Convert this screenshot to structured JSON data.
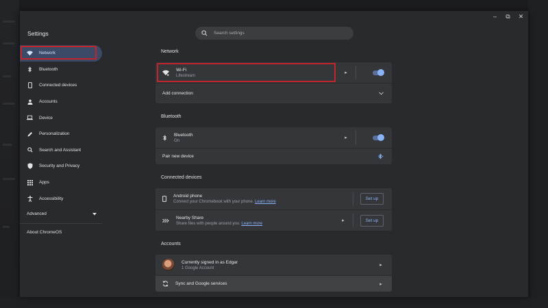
{
  "window": {
    "title": "Settings",
    "controls": [
      "–",
      "⧉",
      "✕"
    ]
  },
  "search": {
    "placeholder": "Search settings"
  },
  "sidebar": {
    "items": [
      {
        "label": "Network",
        "icon": "wifi-icon",
        "active": true
      },
      {
        "label": "Bluetooth",
        "icon": "bluetooth-icon"
      },
      {
        "label": "Connected devices",
        "icon": "phone-icon"
      },
      {
        "label": "Accounts",
        "icon": "person-icon"
      },
      {
        "label": "Device",
        "icon": "laptop-icon"
      },
      {
        "label": "Personalization",
        "icon": "pen-icon"
      },
      {
        "label": "Search and Assistant",
        "icon": "search-icon"
      },
      {
        "label": "Security and Privacy",
        "icon": "shield-icon"
      },
      {
        "label": "Apps",
        "icon": "apps-grid-icon"
      },
      {
        "label": "Accessibility",
        "icon": "accessibility-icon"
      }
    ],
    "advanced": "Advanced",
    "about": "About ChromeOS"
  },
  "network": {
    "title": "Network",
    "wifi": {
      "label": "Wi-Fi",
      "network": "Lifestream",
      "enabled": true
    },
    "add_connection": "Add connection"
  },
  "bluetooth": {
    "title": "Bluetooth",
    "label": "Bluetooth",
    "status": "On",
    "enabled": true,
    "pair": "Pair new device"
  },
  "connected_devices": {
    "title": "Connected devices",
    "android": {
      "label": "Android phone",
      "desc": "Connect your Chromebook with your phone.",
      "link": "Learn more",
      "button": "Set up"
    },
    "nearby": {
      "label": "Nearby Share",
      "desc": "Share files with people around you.",
      "link": "Learn more",
      "button": "Set up"
    }
  },
  "accounts": {
    "title": "Accounts",
    "signed_in": "Currently signed in as Edgar",
    "count": "1 Google Account",
    "sync": "Sync and Google services"
  },
  "colors": {
    "accent": "#8ab4f8",
    "highlight_box": "#c0252c",
    "active_nav": "#3b4a66",
    "card": "#35363a",
    "window": "#292a2d"
  }
}
